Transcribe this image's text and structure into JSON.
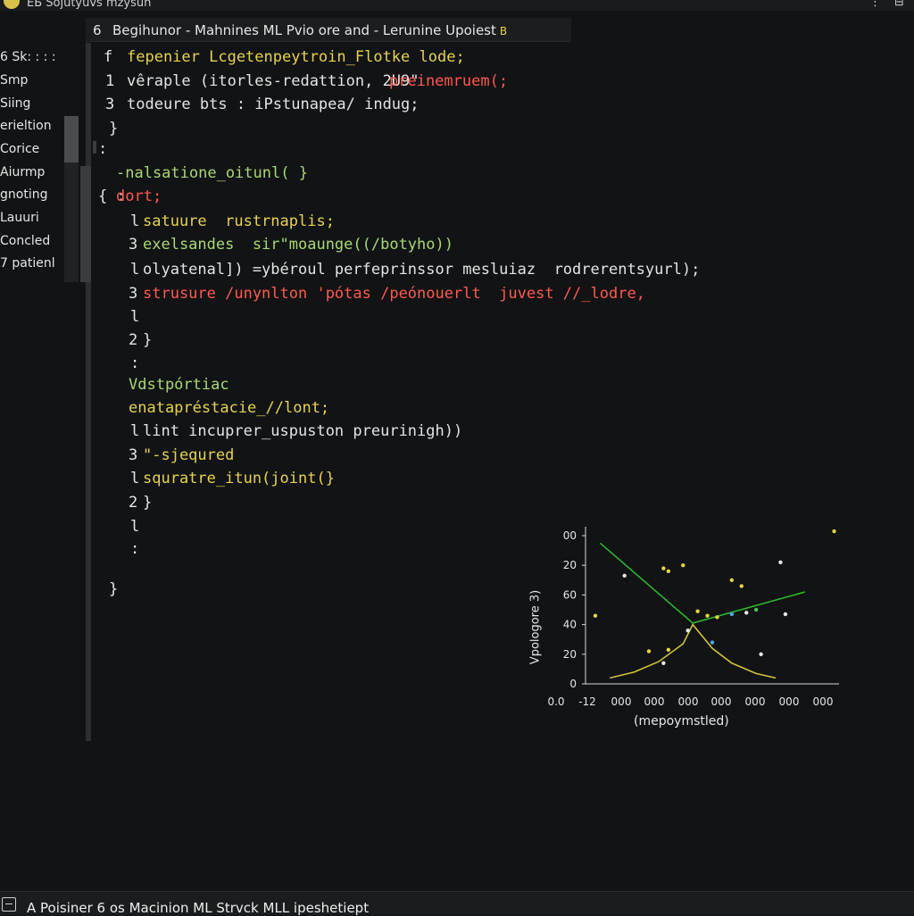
{
  "window": {
    "title_fragment": "ЕБ  Sojutyuvs   mzysun",
    "controls": [
      "⋮",
      "⊟"
    ]
  },
  "tab": {
    "number": "6",
    "title": "Begihunor - Mahnines  ML Pvio ore and - Lerunine Upoiest",
    "modified_marker": "B"
  },
  "sidebar": {
    "items": [
      "6 Sk: : : :",
      "Smp",
      "Siing",
      "erieltion",
      "Corice",
      "Aiurmp",
      "gnoting",
      "Lauuri",
      "Concled",
      "7 patienl"
    ]
  },
  "code": {
    "lines": [
      {
        "num": "f",
        "text": "fepenier Lcgetenpeytroin_Flotke lode;",
        "color": "kw-y"
      },
      {
        "num": "1",
        "text": "vêraple (itorles-redattion, 2U9\"",
        "extra": "preinemruem(;",
        "color": "txt",
        "extra_color": "kw-r"
      },
      {
        "num": "3",
        "text": "todeure bts : iPstunapea/ indug;",
        "color": "txt"
      },
      {
        "num": "}",
        "text": "",
        "color": "txt"
      },
      {
        "num": ":",
        "text": "",
        "color": "txt"
      },
      {
        "num": "",
        "text": "-nalsatione_oitunl( }",
        "color": "kw-g"
      },
      {
        "num": "{ :",
        "text": "dort;",
        "color": "kw-r"
      },
      {
        "num": "l",
        "text": "satuure  rustrnaplis;",
        "color": "kw-y"
      },
      {
        "num": "3",
        "text": "exelsandes  sir\"moaunge((/botyho))",
        "color": "kw-g"
      },
      {
        "num": "l",
        "text": "olyatenal]) =ybéroul perfeprinssor mesluiaz  rodrerentsyurl);",
        "color": "txt"
      },
      {
        "num": "3",
        "text": "strusure /unynlton 'pótas /peónouerlt  juvest //_lodre,",
        "color": "kw-r"
      },
      {
        "num": "l",
        "text": "",
        "color": "txt"
      },
      {
        "num": "2",
        "text": "}",
        "color": "txt"
      },
      {
        "num": ":",
        "text": "",
        "color": "txt"
      },
      {
        "num": "",
        "text": "Vdstpórtiac",
        "color": "kw-g"
      },
      {
        "num": "",
        "text": "enatapréstacie_//lont;",
        "color": "kw-y"
      },
      {
        "num": "l",
        "text": "lint incuprer_uspuston preurinigh))",
        "color": "txt"
      },
      {
        "num": "3",
        "text": "\"-sjequred",
        "color": "kw-y"
      },
      {
        "num": "l",
        "text": "squratre_itun(joint(}",
        "color": "kw-y"
      },
      {
        "num": "2",
        "text": "}",
        "color": "txt"
      },
      {
        "num": "l",
        "text": "",
        "color": "txt"
      },
      {
        "num": ":",
        "text": "",
        "color": "txt"
      },
      {
        "num": "}",
        "text": "",
        "color": "txt"
      }
    ]
  },
  "chart_data": {
    "type": "line",
    "ylabel": "Vpologore 3)",
    "xlabel": "(mepoymstled)",
    "yticks": [
      "00",
      "20",
      "60",
      "40",
      "20",
      "0"
    ],
    "xticks": [
      "0.0",
      "-12",
      "000",
      "000",
      "000",
      "000",
      "000",
      "000",
      "000"
    ],
    "ylim": [
      0,
      100
    ],
    "series": [
      {
        "name": "",
        "color": "#2ab52a",
        "x": [
          0.3,
          2.2,
          4.5
        ],
        "y": [
          95,
          41,
          62
        ]
      },
      {
        "name": "",
        "color": "#d4c23a",
        "x": [
          0.5,
          1.0,
          1.5,
          2.0,
          2.2,
          2.6,
          3.0,
          3.5,
          3.9
        ],
        "y": [
          4,
          8,
          15,
          27,
          40,
          24,
          14,
          7,
          4
        ]
      }
    ],
    "scatter": {
      "colors": {
        "yellow": "#e7d43a",
        "white": "#e6e6e6",
        "blue": "#4ba8e6",
        "green": "#4fc44f"
      },
      "points": [
        {
          "x": 0.2,
          "y": 46,
          "c": "yellow"
        },
        {
          "x": 0.8,
          "y": 73,
          "c": "white"
        },
        {
          "x": 1.6,
          "y": 78,
          "c": "yellow"
        },
        {
          "x": 1.7,
          "y": 76,
          "c": "yellow"
        },
        {
          "x": 2.0,
          "y": 80,
          "c": "yellow"
        },
        {
          "x": 2.1,
          "y": 36,
          "c": "white"
        },
        {
          "x": 2.3,
          "y": 49,
          "c": "yellow"
        },
        {
          "x": 2.5,
          "y": 46,
          "c": "yellow"
        },
        {
          "x": 2.6,
          "y": 28,
          "c": "blue"
        },
        {
          "x": 2.7,
          "y": 45,
          "c": "yellow"
        },
        {
          "x": 3.0,
          "y": 47,
          "c": "blue"
        },
        {
          "x": 3.0,
          "y": 70,
          "c": "yellow"
        },
        {
          "x": 3.2,
          "y": 66,
          "c": "yellow"
        },
        {
          "x": 3.3,
          "y": 48,
          "c": "white"
        },
        {
          "x": 3.5,
          "y": 50,
          "c": "green"
        },
        {
          "x": 4.0,
          "y": 82,
          "c": "white"
        },
        {
          "x": 4.1,
          "y": 47,
          "c": "white"
        },
        {
          "x": 5.1,
          "y": 103,
          "c": "yellow"
        },
        {
          "x": 1.3,
          "y": 22,
          "c": "yellow"
        },
        {
          "x": 1.7,
          "y": 23,
          "c": "yellow"
        },
        {
          "x": 1.6,
          "y": 14,
          "c": "white"
        },
        {
          "x": 3.6,
          "y": 20,
          "c": "white"
        }
      ]
    }
  },
  "status": {
    "text": "A Poisiner 6 os Macinion ML Strvck  MLL ipeshetiept"
  }
}
